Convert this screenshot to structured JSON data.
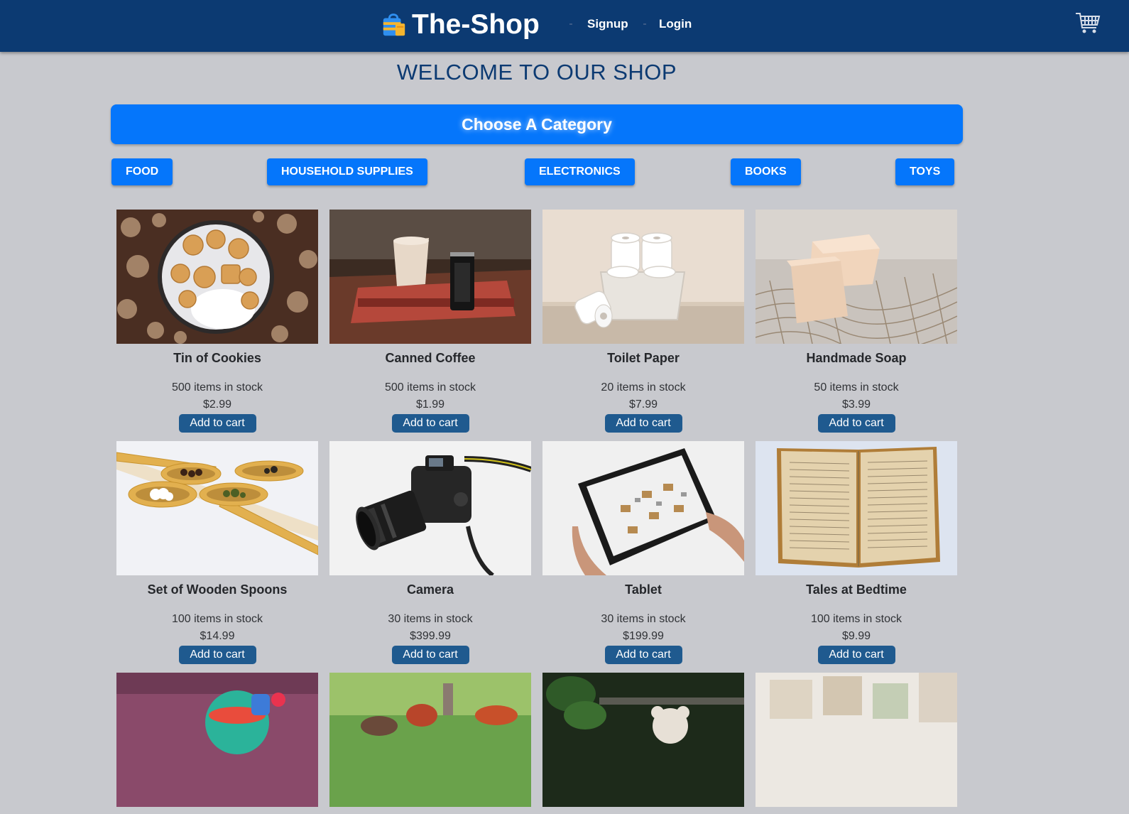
{
  "header": {
    "brand": "The-Shop",
    "nav": {
      "signup": "Signup",
      "login": "Login"
    },
    "colors": {
      "bar": "#0c3a72",
      "text": "#ffffff"
    }
  },
  "main": {
    "welcome": "WELCOME TO OUR SHOP",
    "category_banner": "Choose A Category",
    "categories": [
      "FOOD",
      "HOUSEHOLD SUPPLIES",
      "ELECTRONICS",
      "BOOKS",
      "TOYS"
    ],
    "accent_color": "#0576fb"
  },
  "products": [
    {
      "name": "Tin of Cookies",
      "stock": "500 items in stock",
      "price": "$2.99",
      "button": "Add to cart",
      "image": "cookies-tin-photo"
    },
    {
      "name": "Canned Coffee",
      "stock": "500 items in stock",
      "price": "$1.99",
      "button": "Add to cart",
      "image": "coffee-can-photo"
    },
    {
      "name": "Toilet Paper",
      "stock": "20 items in stock",
      "price": "$7.99",
      "button": "Add to cart",
      "image": "toilet-paper-photo"
    },
    {
      "name": "Handmade Soap",
      "stock": "50 items in stock",
      "price": "$3.99",
      "button": "Add to cart",
      "image": "soap-bars-photo"
    },
    {
      "name": "Set of Wooden Spoons",
      "stock": "100 items in stock",
      "price": "$14.99",
      "button": "Add to cart",
      "image": "wooden-spoons-photo"
    },
    {
      "name": "Camera",
      "stock": "30 items in stock",
      "price": "$399.99",
      "button": "Add to cart",
      "image": "dslr-camera-photo"
    },
    {
      "name": "Tablet",
      "stock": "30 items in stock",
      "price": "$199.99",
      "button": "Add to cart",
      "image": "tablet-hands-photo"
    },
    {
      "name": "Tales at Bedtime",
      "stock": "100 items in stock",
      "price": "$9.99",
      "button": "Add to cart",
      "image": "open-book-photo"
    },
    {
      "name": "",
      "stock": "",
      "price": "",
      "button": "",
      "image": "spinning-top-photo"
    },
    {
      "name": "",
      "stock": "",
      "price": "",
      "button": "",
      "image": "toy-animals-photo"
    },
    {
      "name": "",
      "stock": "",
      "price": "",
      "button": "",
      "image": "teddy-bear-photo"
    },
    {
      "name": "",
      "stock": "",
      "price": "",
      "button": "",
      "image": "toy-blocks-photo"
    }
  ]
}
